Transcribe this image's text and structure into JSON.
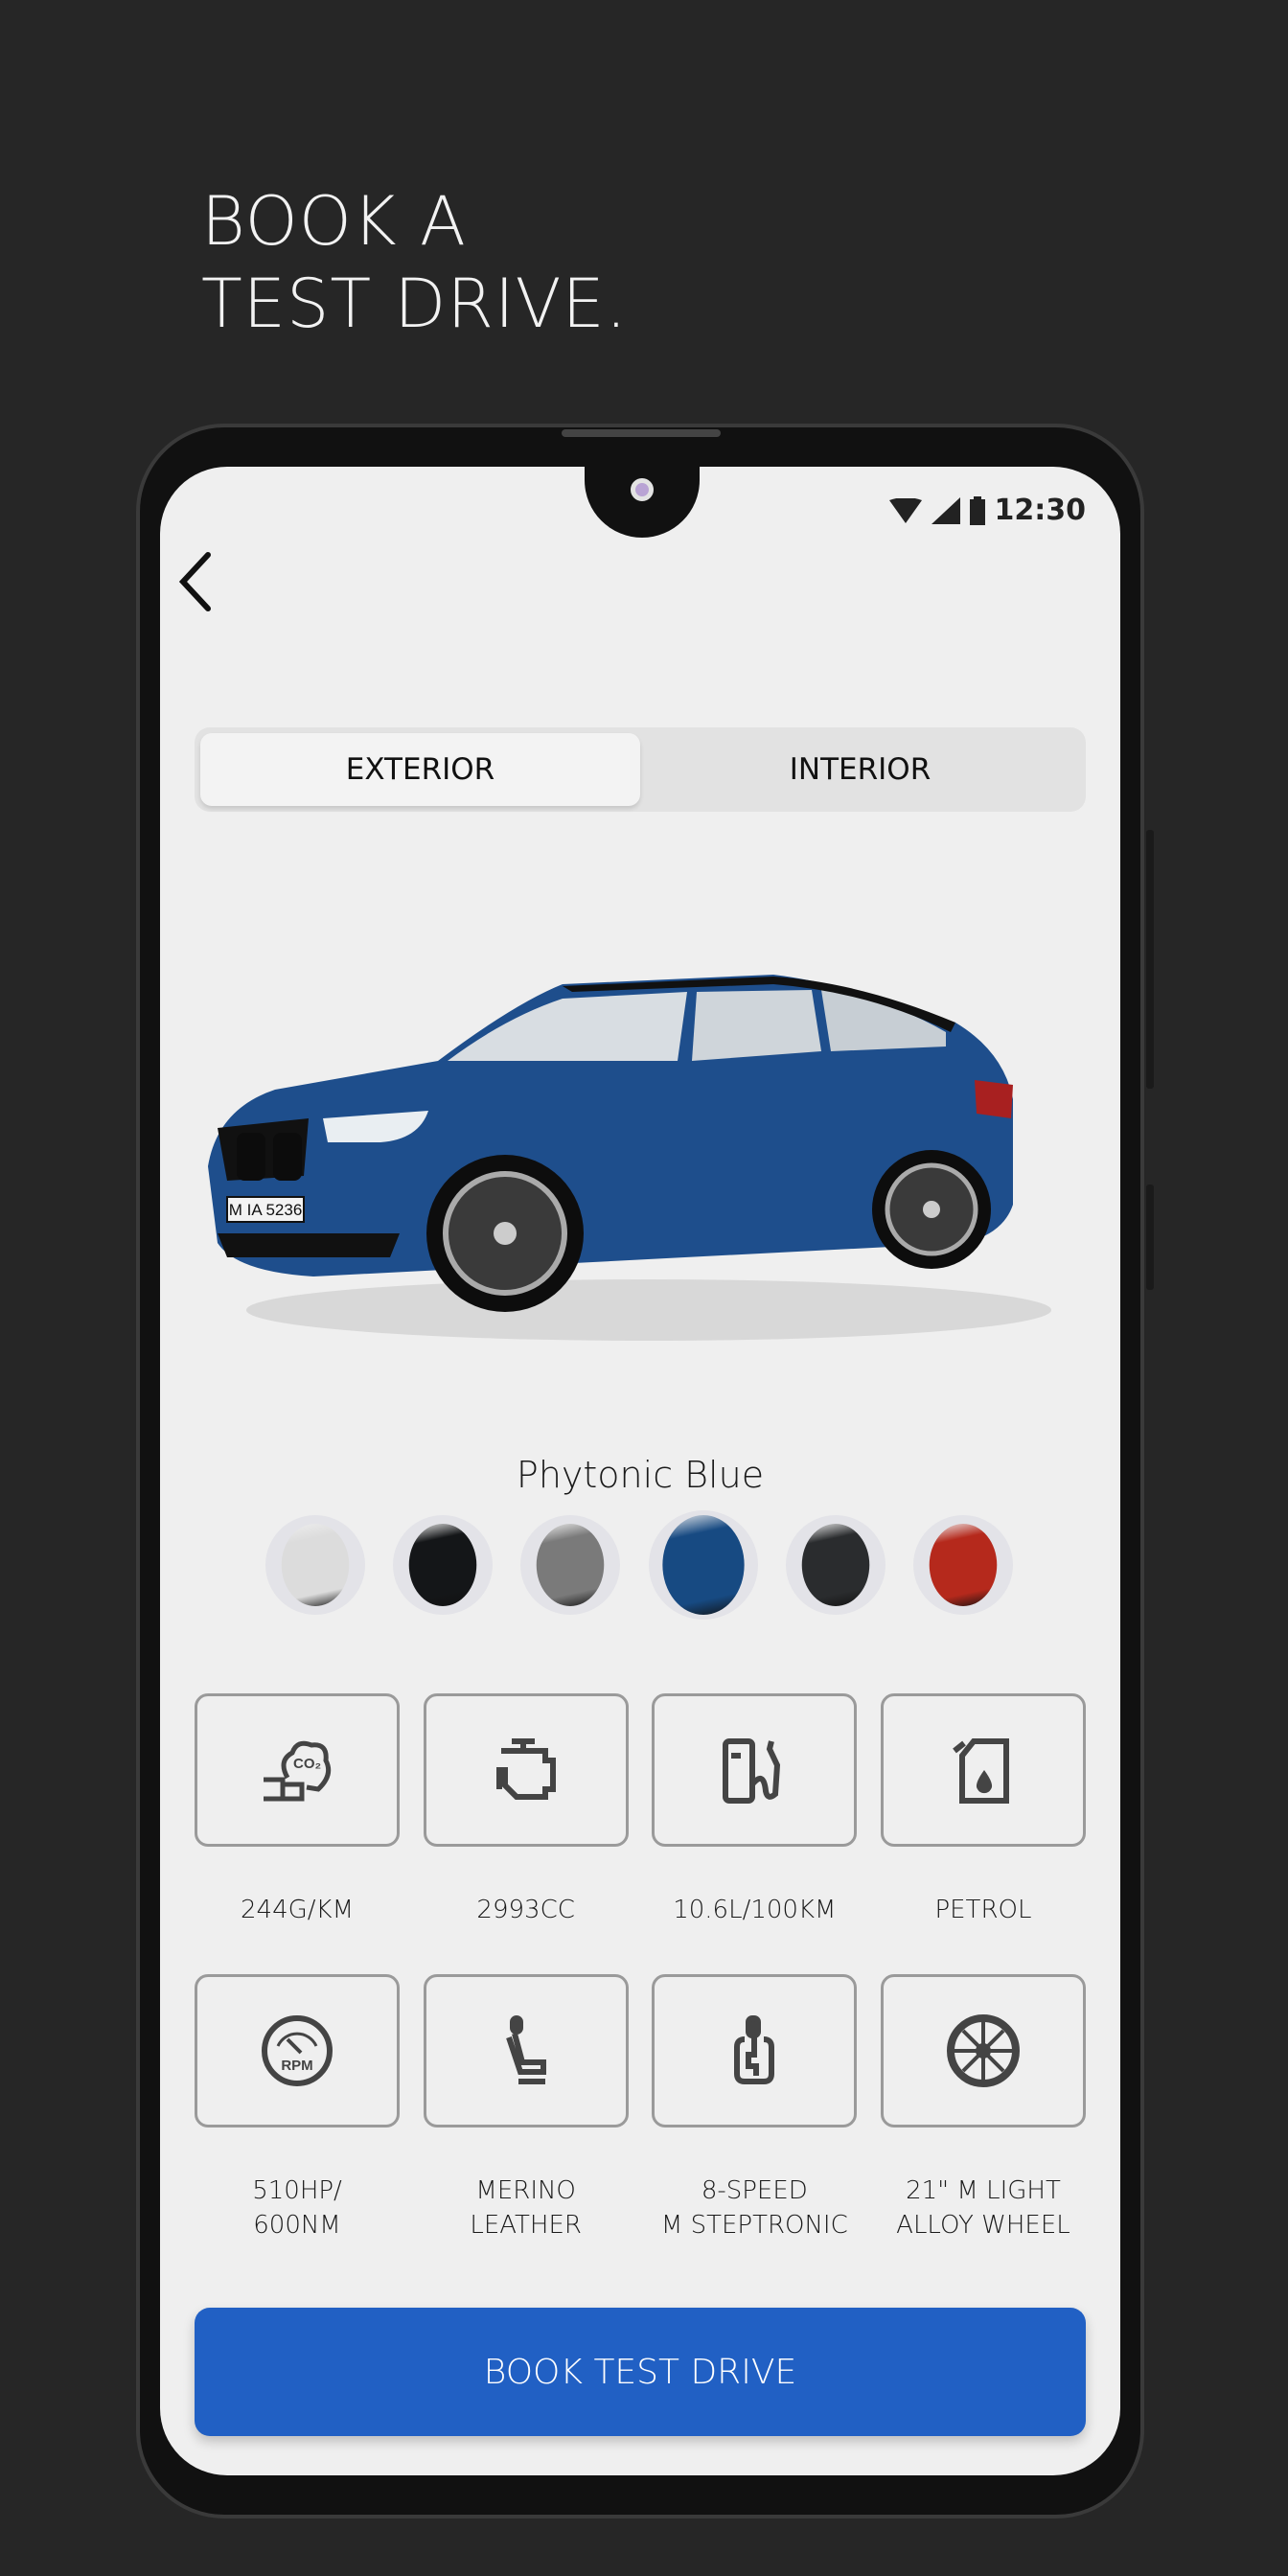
{
  "headline": {
    "line1": "BOOK A",
    "line2": "TEST DRIVE."
  },
  "status_bar": {
    "time": "12:30",
    "icons": [
      "wifi-icon",
      "signal-icon",
      "battery-icon"
    ]
  },
  "nav": {
    "back_icon": "chevron-left-icon"
  },
  "tabs": [
    {
      "label": "EXTERIOR",
      "active": true
    },
    {
      "label": "INTERIOR",
      "active": false
    }
  ],
  "car": {
    "plate": "M IA 5236",
    "color": "#1e4e8c"
  },
  "selected_color": "Phytonic Blue",
  "swatches": [
    {
      "color": "#dcdcdc",
      "selected": false
    },
    {
      "color": "#141618",
      "selected": false
    },
    {
      "color": "#7a7a7a",
      "selected": false
    },
    {
      "color": "#174a82",
      "selected": true
    },
    {
      "color": "#2a2c2e",
      "selected": false
    },
    {
      "color": "#b5291c",
      "selected": false
    }
  ],
  "specs": [
    {
      "icon": "co2-emission-icon",
      "label": "244G/KM"
    },
    {
      "icon": "engine-icon",
      "label": "2993CC"
    },
    {
      "icon": "fuel-pump-icon",
      "label": "10.6L/100KM"
    },
    {
      "icon": "fuel-canister-icon",
      "label": "PETROL"
    },
    {
      "icon": "rpm-gauge-icon",
      "label": "510HP/\n600NM"
    },
    {
      "icon": "seat-icon",
      "label": "MERINO\nLEATHER"
    },
    {
      "icon": "gear-shift-icon",
      "label": "8-SPEED\nM STEPTRONIC"
    },
    {
      "icon": "wheel-icon",
      "label": "21\" M LIGHT\nALLOY WHEEL"
    }
  ],
  "cta": {
    "label": "BOOK TEST DRIVE",
    "color": "#2160c4"
  }
}
